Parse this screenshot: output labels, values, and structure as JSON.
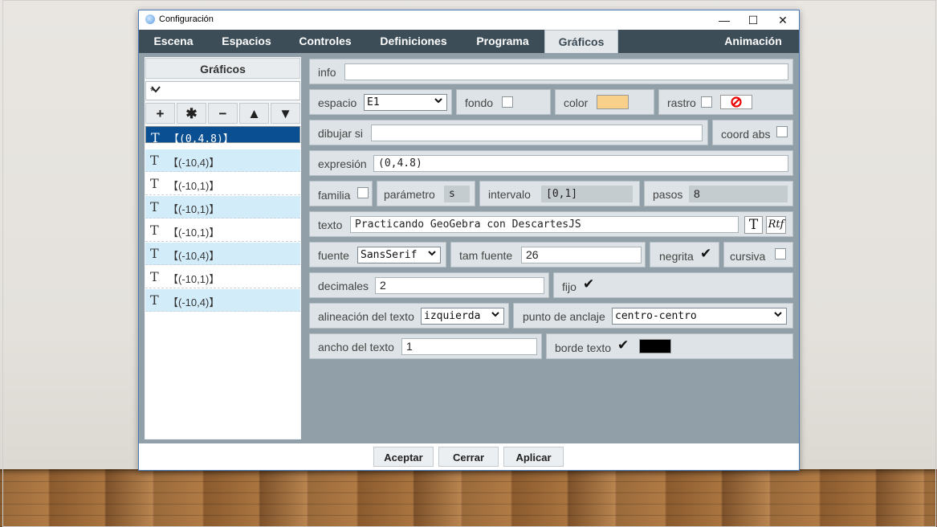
{
  "window": {
    "title": "Configuración",
    "minimize_glyph": "—",
    "maximize_glyph": "☐",
    "close_glyph": "✕"
  },
  "menu": {
    "tabs": [
      "Escena",
      "Espacios",
      "Controles",
      "Definiciones",
      "Programa",
      "Gráficos",
      "Animación"
    ],
    "active": "Gráficos"
  },
  "left": {
    "title": "Gráficos",
    "filter": "*",
    "buttons": [
      "+",
      "✱",
      "−",
      "▲",
      "▼"
    ],
    "items": [
      {
        "icon": "T",
        "text": "(0,4.8)",
        "selected": true
      },
      {
        "icon": "T",
        "text": "(-10,4)"
      },
      {
        "icon": "T",
        "text": "(-10,1)"
      },
      {
        "icon": "T",
        "text": "(-10,1)"
      },
      {
        "icon": "T",
        "text": "(-10,1)"
      },
      {
        "icon": "T",
        "text": "(-10,4)"
      },
      {
        "icon": "T",
        "text": "(-10,1)"
      },
      {
        "icon": "T",
        "text": "(-10,4)"
      }
    ]
  },
  "form": {
    "info": {
      "label": "info",
      "value": ""
    },
    "espacio": {
      "label": "espacio",
      "value": "E1"
    },
    "fondo": {
      "label": "fondo",
      "checked": false
    },
    "color": {
      "label": "color",
      "value": "#f8d08a"
    },
    "rastro": {
      "label": "rastro",
      "checked": false
    },
    "dibujar_si": {
      "label": "dibujar si",
      "value": ""
    },
    "coord_abs": {
      "label": "coord abs",
      "checked": false
    },
    "expresion": {
      "label": "expresión",
      "value": "(0,4.8)"
    },
    "familia": {
      "label": "familia",
      "checked": false
    },
    "parametro": {
      "label": "parámetro",
      "value": "s"
    },
    "intervalo": {
      "label": "intervalo",
      "value": "[0,1]"
    },
    "pasos": {
      "label": "pasos",
      "value": "8"
    },
    "texto": {
      "label": "texto",
      "value": "Practicando GeoGebra con DescartesJS",
      "btn_t": "T",
      "btn_rtf": "Rtf"
    },
    "fuente": {
      "label": "fuente",
      "value": "SansSerif"
    },
    "tam_fuente": {
      "label": "tam fuente",
      "value": "26"
    },
    "negrita": {
      "label": "negrita",
      "checked": true
    },
    "cursiva": {
      "label": "cursiva",
      "checked": false
    },
    "decimales": {
      "label": "decimales",
      "value": "2"
    },
    "fijo": {
      "label": "fijo",
      "checked": true
    },
    "alineacion": {
      "label": "alineación del texto",
      "value": "izquierda"
    },
    "anclaje": {
      "label": "punto de anclaje",
      "value": "centro-centro"
    },
    "ancho": {
      "label": "ancho del texto",
      "value": "1"
    },
    "borde": {
      "label": "borde texto",
      "checked": true,
      "color": "#000000"
    }
  },
  "footer": {
    "accept": "Aceptar",
    "close": "Cerrar",
    "apply": "Aplicar"
  },
  "glyphs": {
    "chevron": "⌄",
    "check": "✔",
    "no": "⊘"
  }
}
